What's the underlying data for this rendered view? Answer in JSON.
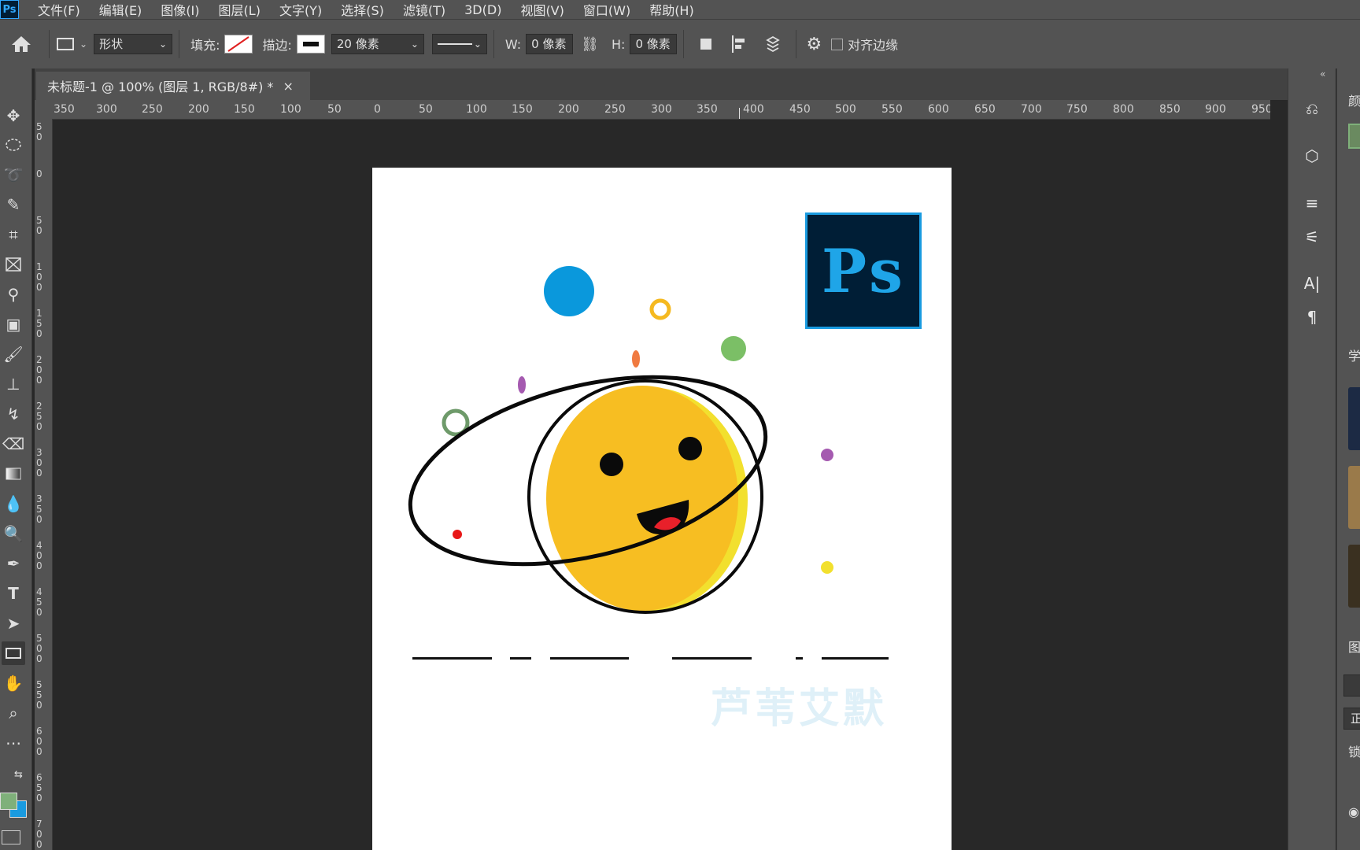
{
  "app": {
    "logo": "Ps"
  },
  "menu": [
    "文件(F)",
    "编辑(E)",
    "图像(I)",
    "图层(L)",
    "文字(Y)",
    "选择(S)",
    "滤镜(T)",
    "3D(D)",
    "视图(V)",
    "窗口(W)",
    "帮助(H)"
  ],
  "options": {
    "shape_mode": "形状",
    "fill_label": "填充:",
    "stroke_label": "描边:",
    "stroke_size": "20 像素",
    "w_label": "W:",
    "w_value": "0 像素",
    "h_label": "H:",
    "h_value": "0 像素",
    "align_edges": "对齐边缘",
    "align_edges_checked": false
  },
  "document_tab": {
    "title": "未标题-1 @ 100% (图层 1, RGB/8#) *",
    "close": "×"
  },
  "ruler_h": [
    "350",
    "300",
    "250",
    "200",
    "150",
    "100",
    "50",
    "0",
    "50",
    "100",
    "150",
    "200",
    "250",
    "300",
    "350",
    "400",
    "450",
    "500",
    "550",
    "600",
    "650",
    "700",
    "750",
    "800",
    "850",
    "900",
    "950"
  ],
  "ruler_v": [
    "5 0",
    "0",
    "5 0",
    "1 0 0",
    "1 5 0",
    "2 0 0",
    "2 5 0",
    "3 0 0",
    "3 5 0",
    "4 0 0",
    "4 5 0",
    "5 0 0",
    "5 5 0",
    "6 0 0",
    "6 5 0",
    "7 0 0"
  ],
  "artwork": {
    "logo_text": "Ps",
    "watermark": "芦苇艾默",
    "colors": {
      "planet": "#f7be22",
      "planet_rim": "#f2e02e",
      "blue_dot": "#0a98dc",
      "green_dot": "#7bbf66",
      "logo_bg": "#001e36",
      "logo_fg": "#1fa5e8"
    }
  },
  "right_panel": {
    "labels": [
      "颜",
      "学",
      "图",
      "正",
      "锁"
    ]
  },
  "colors": {
    "foreground": "#7fb07a",
    "background": "#1a9be0"
  }
}
